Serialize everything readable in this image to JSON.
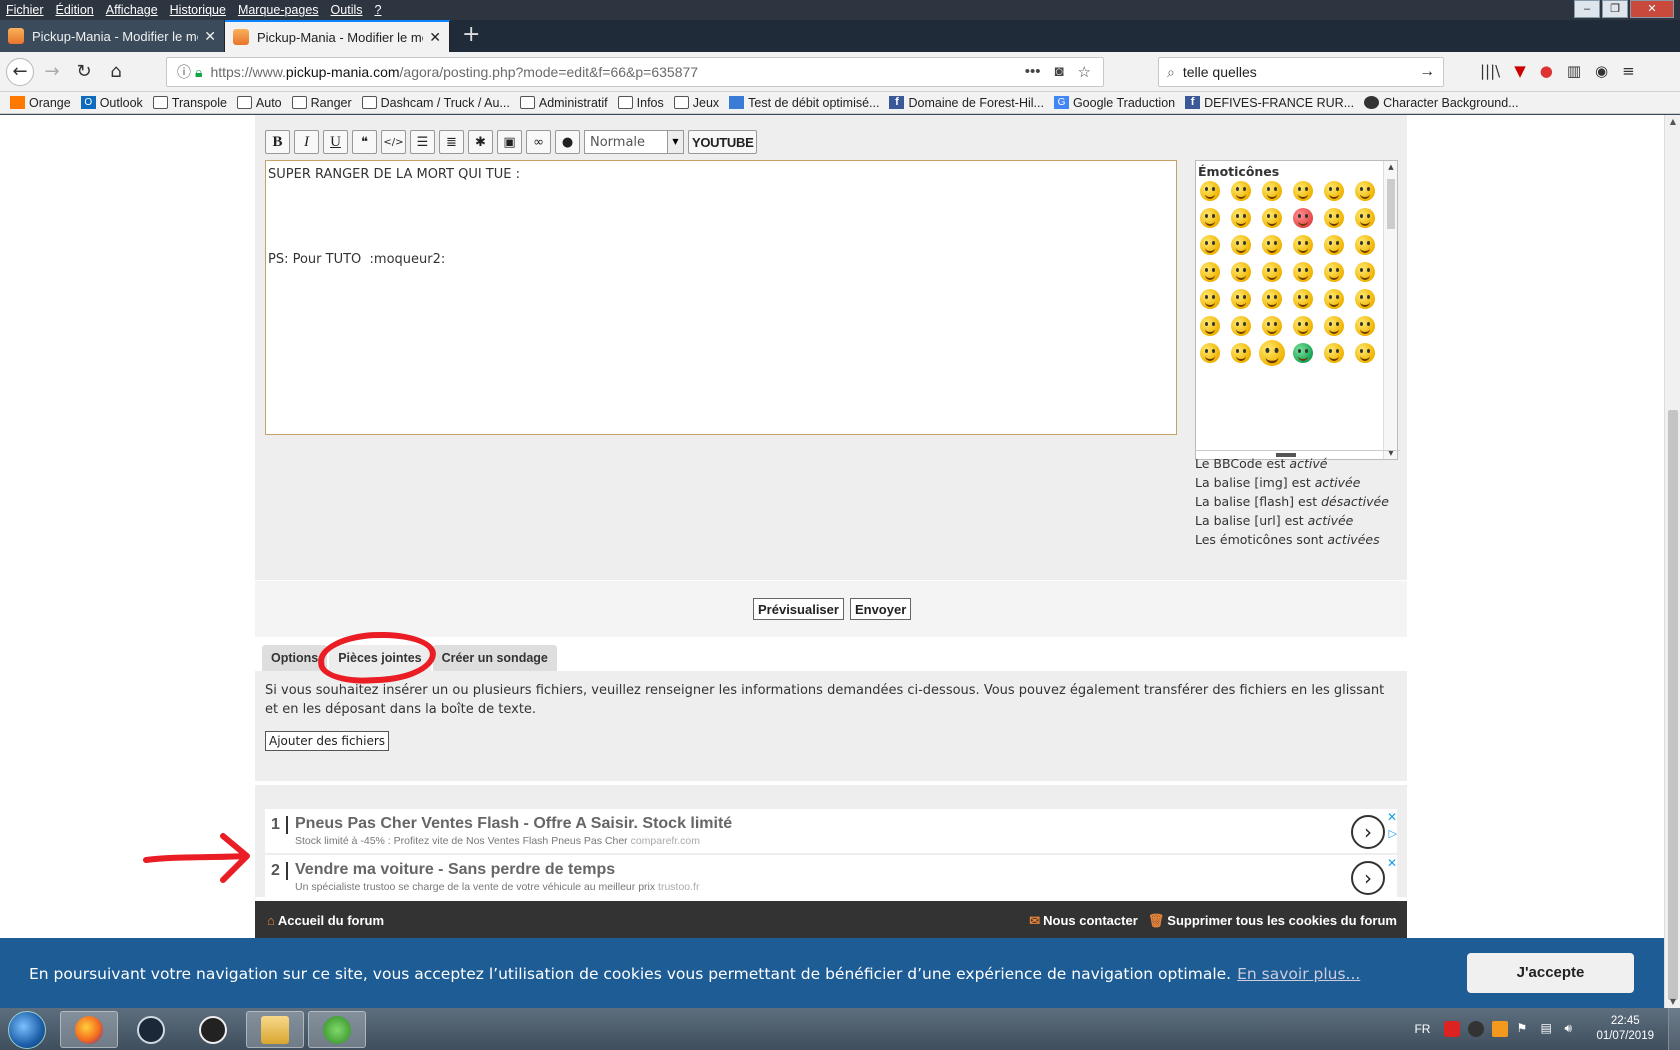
{
  "menubar": {
    "items": [
      "Fichier",
      "Édition",
      "Affichage",
      "Historique",
      "Marque-pages",
      "Outils",
      "?"
    ]
  },
  "tabs": [
    {
      "label": "Pickup-Mania - Modifier le me",
      "close": "✕"
    },
    {
      "label": "Pickup-Mania - Modifier le me",
      "close": "✕"
    }
  ],
  "new_tab": "+",
  "navbar": {
    "url_prefix": "https://www.",
    "url_domain": "pickup-mania.com",
    "url_path": "/agora/posting.php?mode=edit&f=66&p=635877",
    "search_value": "telle quelles"
  },
  "bookmarks": [
    {
      "label": "Orange",
      "icon": "orange-icon"
    },
    {
      "label": "Outlook",
      "icon": "outlook-icon"
    },
    {
      "label": "Transpole",
      "icon": "folder-icon"
    },
    {
      "label": "Auto",
      "icon": "folder-icon"
    },
    {
      "label": "Ranger",
      "icon": "folder-icon"
    },
    {
      "label": "Dashcam / Truck / Au...",
      "icon": "folder-icon"
    },
    {
      "label": "Administratif",
      "icon": "folder-icon"
    },
    {
      "label": "Infos",
      "icon": "folder-icon"
    },
    {
      "label": "Jeux",
      "icon": "folder-icon"
    },
    {
      "label": "Test de débit optimisé...",
      "icon": "speedtest-icon"
    },
    {
      "label": "Domaine de Forest-Hil...",
      "icon": "facebook-icon"
    },
    {
      "label": "Google Traduction",
      "icon": "google-translate-icon"
    },
    {
      "label": "DEFIVES-FRANCE RUR...",
      "icon": "facebook-icon"
    },
    {
      "label": "Character Background...",
      "icon": "globe-icon"
    }
  ],
  "editor": {
    "size_select": "Normale",
    "youtube_label": "YOUTUBE",
    "message": "SUPER RANGER DE LA MORT QUI TUE :\n\n\n\n\nPS: Pour TUTO  :moqueur2:",
    "emoticons_title": "Émoticônes",
    "bbcode_lines": [
      {
        "text": "Le BBCode est ",
        "state": "activé"
      },
      {
        "text": "La balise [img] est ",
        "state": "activée"
      },
      {
        "text": "La balise [flash] est ",
        "state": "désactivée"
      },
      {
        "text": "La balise [url] est ",
        "state": "activée"
      },
      {
        "text": "Les émoticônes sont ",
        "state": "activées"
      }
    ]
  },
  "submit": {
    "preview_label": "Prévisualiser",
    "send_label": "Envoyer"
  },
  "option_tabs": [
    "Options",
    "Pièces jointes",
    "Créer un sondage"
  ],
  "attachments": {
    "instructions": "Si vous souhaitez insérer un ou plusieurs fichiers, veuillez renseigner les informations demandées ci-dessous. Vous pouvez également transférer des fichiers en les glissant et en les déposant dans la boîte de texte.",
    "add_files_label": "Ajouter des fichiers"
  },
  "ads": [
    {
      "num": "1",
      "title": "Pneus Pas Cher Ventes Flash - Offre A Saisir. Stock limité",
      "desc": "Stock limité à -45% : Profitez vite de Nos Ventes Flash Pneus Pas Cher",
      "source": "comparefr.com"
    },
    {
      "num": "2",
      "title": "Vendre ma voiture - Sans perdre de temps",
      "desc": "Un spécialiste trustoo se charge de la vente de votre véhicule au meilleur prix",
      "source": "trustoo.fr"
    }
  ],
  "footer": {
    "home_label": "Accueil du forum",
    "contact_label": "Nous contacter",
    "cookies_label": "Supprimer tous les cookies du forum"
  },
  "cookie_banner": {
    "text": "En poursuivant votre navigation sur ce site, vous acceptez l’utilisation de cookies vous permettant de bénéficier d’une expérience de navigation optimale.",
    "link": "En savoir plus...",
    "accept": "J'accepte"
  },
  "taskbar": {
    "lang": "FR",
    "time": "22:45",
    "date": "01/07/2019"
  },
  "colors": {
    "annotation_red": "#ea1c24",
    "cookie_banner": "#1d5c94",
    "footer": "#333333",
    "tab_active_accent": "#0a84ff"
  }
}
